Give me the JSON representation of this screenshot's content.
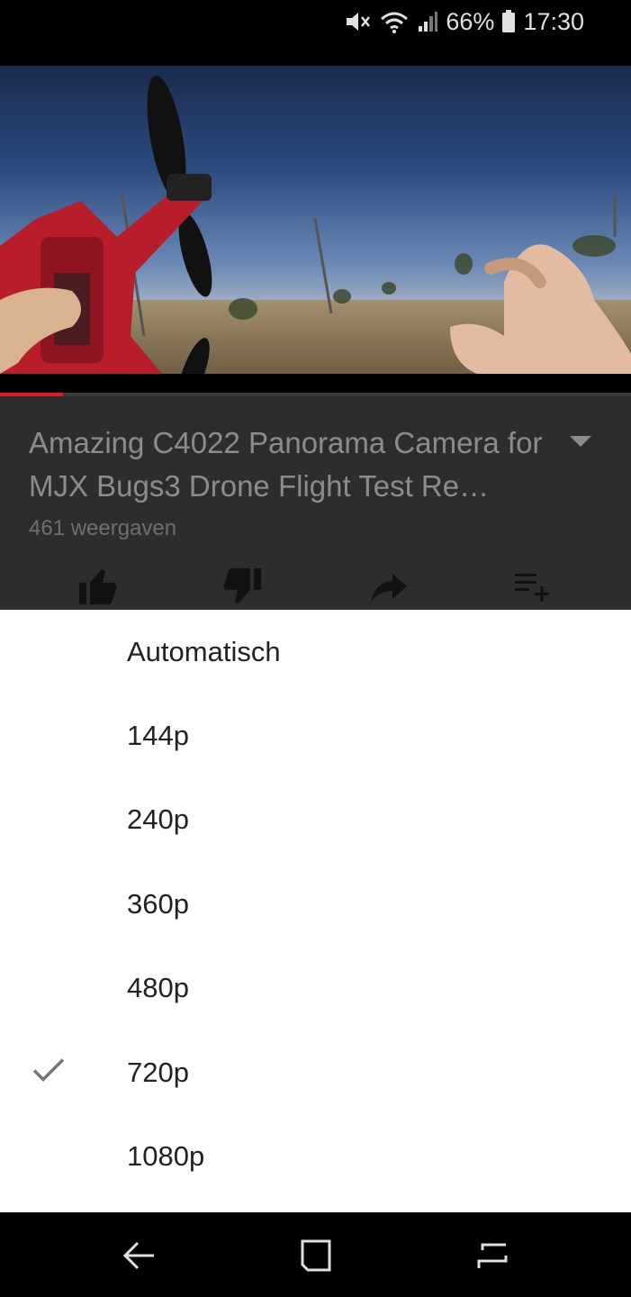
{
  "status_bar": {
    "battery_percent": "66%",
    "time": "17:30"
  },
  "video": {
    "progress_fraction": 0.1,
    "title": "Amazing C4022 Panorama Camera for MJX Bugs3 Drone Flight Test Re…",
    "views": "461 weergaven"
  },
  "actions": [
    {
      "icon": "thumb-up-icon"
    },
    {
      "icon": "thumb-down-icon"
    },
    {
      "icon": "share-icon"
    },
    {
      "icon": "add-to-playlist-icon"
    }
  ],
  "quality_menu": {
    "selected": "720p",
    "options": [
      {
        "label": "Automatisch"
      },
      {
        "label": "144p"
      },
      {
        "label": "240p"
      },
      {
        "label": "360p"
      },
      {
        "label": "480p"
      },
      {
        "label": "720p",
        "checked": true
      },
      {
        "label": "1080p"
      }
    ]
  },
  "nav_bar": {
    "buttons": [
      "back-icon",
      "home-icon",
      "recent-apps-icon"
    ]
  },
  "colors": {
    "accent_red": "#d71e28",
    "overlay_grey": "#2d2d2d",
    "sheet_bg": "#ffffff"
  }
}
